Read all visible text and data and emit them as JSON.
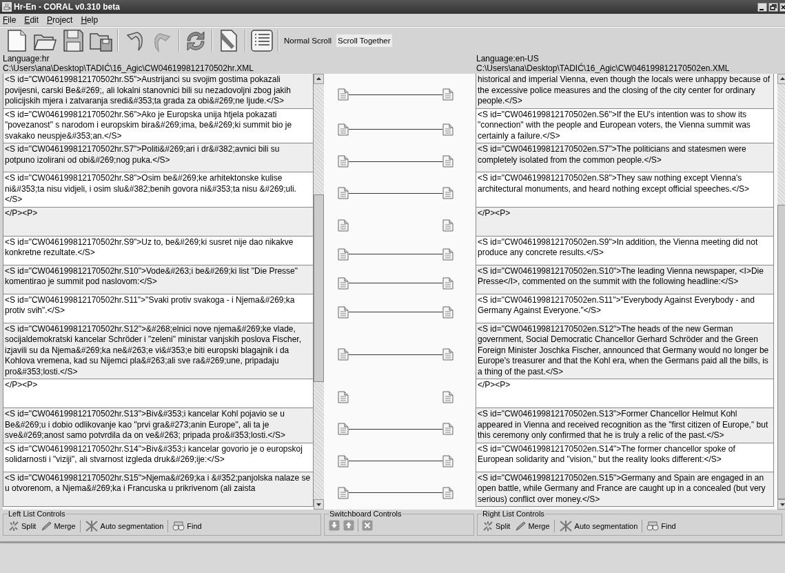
{
  "window": {
    "title": "Hr-En - CORAL v0.310 beta"
  },
  "menu": [
    "File",
    "Edit",
    "Project",
    "Help"
  ],
  "scroll_modes": [
    {
      "label": "Normal Scroll",
      "selected": false
    },
    {
      "label": "Scroll Together",
      "selected": true
    }
  ],
  "left_panel": {
    "language": "Language:hr",
    "path": "C:\\Users\\ana\\Desktop\\TADIĆ\\16_Agic\\CW046199812170502hr.XML"
  },
  "right_panel": {
    "language": "Language:en-US",
    "path": "C:\\Users\\ana\\Desktop\\TADIĆ\\16_Agic\\CW046199812170502en.XML"
  },
  "rows": [
    {
      "left": "<S id=\"CW046199812170502hr.S5\">Austrijanci su svojim gostima pokazali povijesni, carski Be&#269;, ali lokalni stanovnici bili su nezadovoljni zbog jakih policijskih mjera i zatvaranja sredi&#353;ta grada za obi&#269;ne ljude.</S>",
      "right": "historical and imperial Vienna, even though the locals were unhappy because of the excessive police measures and the closing of the city center for ordinary people.</S>",
      "linked": true
    },
    {
      "left": "<S id=\"CW046199812170502hr.S6\">Ako je Europska unija htjela pokazati \"povezanost\" s narodom i europskim bira&#269;ima, be&#269;ki summit bio je svakako neuspje&#353;an.</S>",
      "right": "<S id=\"CW046199812170502en.S6\">If the EU's intention was to show its \"connection\" with the people and European voters, the Vienna summit was certainly a failure.</S>",
      "linked": true
    },
    {
      "left": "<S id=\"CW046199812170502hr.S7\">Politi&#269;ari i dr&#382;avnici bili su potpuno izolirani od obi&#269;nog puka.</S>",
      "right": "<S id=\"CW046199812170502en.S7\">The politicians and statesmen were completely isolated from the common people.</S>",
      "linked": true
    },
    {
      "left": "<S id=\"CW046199812170502hr.S8\">Osim be&#269;ke arhitektonske kulise ni&#353;ta nisu vidjeli, i osim slu&#382;benih govora ni&#353;ta nisu &#269;uli.</S>",
      "right": "<S id=\"CW046199812170502en.S8\">They saw nothing except Vienna's architectural monuments, and heard nothing except official speeches.</S>",
      "linked": true
    },
    {
      "left": "</P><P>",
      "right": "</P><P>",
      "linked": false
    },
    {
      "left": "<S id=\"CW046199812170502hr.S9\">Uz to, be&#269;ki susret nije dao nikakve konkretne rezultate.</S>",
      "right": "<S id=\"CW046199812170502en.S9\">In addition, the Vienna meeting did not produce any concrete results.</S>",
      "linked": true
    },
    {
      "left": "<S id=\"CW046199812170502hr.S10\">Vode&#263;i be&#269;ki list \"Die Presse\" komentirao je summit pod naslovom:</S>",
      "right": "<S id=\"CW046199812170502en.S10\">The leading Vienna newspaper, <I>Die Presse</I>, commented on the summit with the following headline:</S>",
      "linked": true
    },
    {
      "left": "<S id=\"CW046199812170502hr.S11\">\"Svaki protiv svakoga - i Njema&#269;ka protiv svih\".</S>",
      "right": "<S id=\"CW046199812170502en.S11\">\"Everybody Against Everybody - and Germany Against Everyone.\"</S>",
      "linked": true
    },
    {
      "left": "<S id=\"CW046199812170502hr.S12\">&#268;elnici nove njema&#269;ke vlade, socijaldemokratski kancelar Schröder i \"zeleni\" ministar vanjskih poslova Fischer, izjavili su da Njema&#269;ka ne&#263;e vi&#353;e biti europski blagajnik i da Kohlova vremena, kad su Nijemci pla&#263;ali sve ra&#269;une, pripadaju pro&#353;losti.</S>",
      "right": "<S id=\"CW046199812170502en.S12\">The heads of the new German government, Social Democratic Chancellor Gerhard Schröder and the Green Foreign Minister Joschka Fischer, announced that Germany would no longer be Europe's treasurer and that the Kohl era, when the Germans paid all the bills, is a thing of the past.</S>",
      "linked": true
    },
    {
      "left": "</P><P>",
      "right": "</P><P>",
      "linked": false
    },
    {
      "left": "<S id=\"CW046199812170502hr.S13\">Biv&#353;i kancelar Kohl pojavio se u Be&#269;u i dobio odlikovanje kao \"prvi gra&#273;anin Europe\", ali ta je sve&#269;anost samo potvrdila da on ve&#263; pripada pro&#353;losti.</S>",
      "right": "<S id=\"CW046199812170502en.S13\">Former Chancellor Helmut Kohl appeared in Vienna and received recognition as the \"first citizen of Europe,\" but this ceremony only confirmed that he is truly a relic of the past.</S>",
      "linked": true
    },
    {
      "left": "<S id=\"CW046199812170502hr.S14\">Biv&#353;i kancelar govorio je o europskoj solidarnosti i \"viziji\", ali stvarnost izgleda druk&#269;ije:</S>",
      "right": "<S id=\"CW046199812170502en.S14\">The former chancellor spoke of European solidarity and \"vision,\" but the reality looks different:</S>",
      "linked": true
    },
    {
      "left": "<S id=\"CW046199812170502hr.S15\">Njema&#269;ka i &#352;panjolska nalaze se u otvorenom, a Njema&#269;ka i Francuska u prikrivenom (ali zaista",
      "right": "<S id=\"CW046199812170502en.S15\">Germany and Spain are engaged in an open battle, while Germany and France are caught up in a concealed (but very serious) conflict over money.</S>",
      "linked": true
    }
  ],
  "left_controls": {
    "title": "Left List Controls",
    "groups": [
      [
        {
          "kind": "split",
          "label": "Split"
        },
        {
          "kind": "merge",
          "label": "Merge"
        }
      ],
      [
        {
          "kind": "auto",
          "label": "Auto segmentation"
        }
      ],
      [
        {
          "kind": "find",
          "label": "Find"
        }
      ]
    ]
  },
  "switchboard": {
    "title": "Switchboard Controls",
    "groups": [
      [
        {
          "kind": "down"
        },
        {
          "kind": "up"
        }
      ],
      [
        {
          "kind": "remove"
        }
      ]
    ]
  },
  "right_controls": {
    "title": "Right List Controls",
    "groups": [
      [
        {
          "kind": "split",
          "label": "Split"
        },
        {
          "kind": "merge",
          "label": "Merge"
        }
      ],
      [
        {
          "kind": "auto",
          "label": "Auto segmentation"
        }
      ],
      [
        {
          "kind": "find",
          "label": "Find"
        }
      ]
    ]
  }
}
